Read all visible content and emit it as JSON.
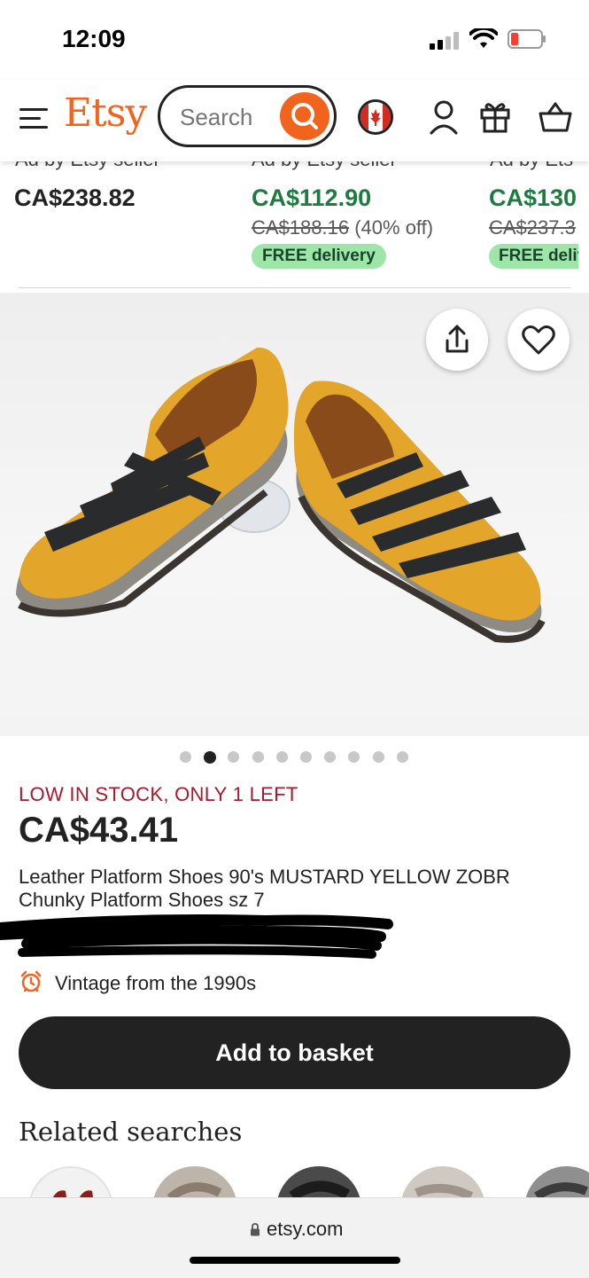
{
  "status_bar": {
    "time": "12:09"
  },
  "header": {
    "logo": "Etsy",
    "search_placeholder": "Search",
    "brand_color": "#F1641E",
    "icons": [
      "menu-icon",
      "search-icon",
      "canada-flag-icon",
      "user-icon",
      "gift-icon",
      "basket-icon"
    ]
  },
  "carousel": [
    {
      "ad_label": "Ad by Etsy seller",
      "price": "CA$238.82"
    },
    {
      "ad_label": "Ad by Etsy seller",
      "price": "CA$112.90",
      "original_price": "CA$188.16",
      "discount": "(40% off)",
      "badge": "FREE delivery"
    },
    {
      "ad_label": "Ad by Ets",
      "price": "CA$130",
      "original_price": "CA$237.3",
      "badge": "FREE deliv"
    }
  ],
  "product": {
    "image_alt": "Mustard yellow leather platform shoes with black straps",
    "image_dots": 10,
    "image_active_index": 1,
    "stock_note": "LOW IN STOCK, ONLY 1 LEFT",
    "price": "CA$43.41",
    "title": "Leather Platform Shoes 90's MUSTARD YELLOW ZOBR Chunky Platform Shoes sz 7",
    "vintage": "Vintage from the 1990s",
    "add_button": "Add to basket",
    "stock_color": "#A61A2E"
  },
  "related": {
    "heading": "Related searches"
  },
  "browser": {
    "url": "etsy.com"
  }
}
